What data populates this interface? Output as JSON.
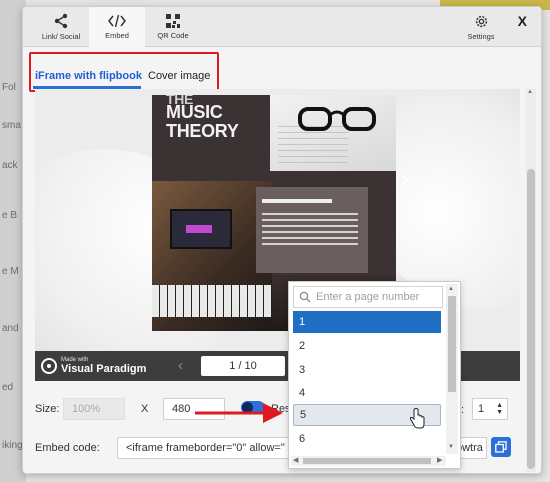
{
  "background_app": {
    "side_labels": [
      "Fol",
      "ack",
      "e B",
      "e M",
      "and",
      "ed",
      "iking",
      "sma"
    ]
  },
  "modal": {
    "top_tabs": [
      {
        "label": "Link/ Social",
        "icon": "share-icon"
      },
      {
        "label": "Embed",
        "icon": "code-icon"
      },
      {
        "label": "QR Code",
        "icon": "qr-code-icon"
      }
    ],
    "settings_label": "Settings",
    "close_label": "X",
    "sub_tabs": [
      {
        "label": "iFrame with flipbook",
        "active": true
      },
      {
        "label": "Cover image",
        "active": false
      }
    ],
    "preview": {
      "book_title_fragment": "THE",
      "book_title": [
        "MUSIC",
        "THEORY"
      ],
      "branding_small": "Made with",
      "branding_big": "Visual Paradigm",
      "page_indicator": "1 / 10",
      "prev_arrow": "‹",
      "next_arrow": "›"
    },
    "size_row": {
      "size_label": "Size:",
      "size_value": "100%",
      "x_label": "X",
      "height_value": "480",
      "responsive_label": "Res",
      "responsive_on": true,
      "start_page_value": "1"
    },
    "embed_row": {
      "label": "Embed code:",
      "code_value": "<iframe frameborder=\"0\" allow=\"",
      "code_tail": "owtra"
    },
    "page_dropdown": {
      "placeholder": "Enter a page number",
      "items": [
        "1",
        "2",
        "3",
        "4",
        "5",
        "6"
      ],
      "selected": "1",
      "hovered": "5"
    }
  },
  "colors": {
    "accent": "#2b6fd8",
    "selected_item": "#1f6fc4",
    "annotation_red": "#e0181f"
  }
}
